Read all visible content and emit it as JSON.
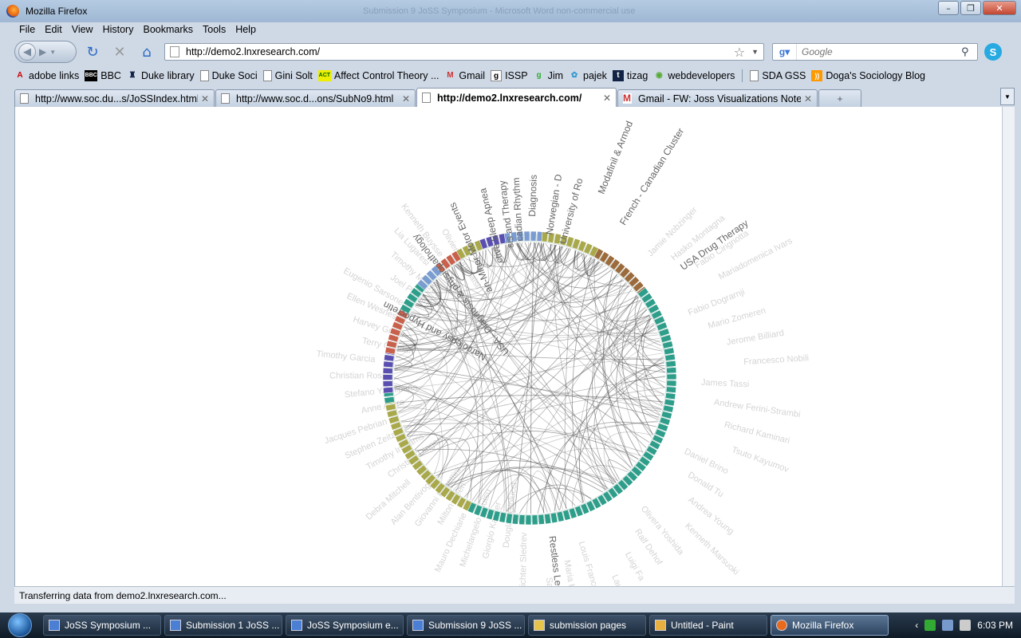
{
  "window": {
    "title": "Mozilla Firefox",
    "ghost_title": "Submission 9 JoSS Symposium - Microsoft Word non-commercial use"
  },
  "menu": [
    "File",
    "Edit",
    "View",
    "History",
    "Bookmarks",
    "Tools",
    "Help"
  ],
  "nav": {
    "url": "http://demo2.lnxresearch.com/",
    "search_placeholder": "Google"
  },
  "bookmarks": [
    {
      "label": "adobe links",
      "icon": "adobe-icon"
    },
    {
      "label": "BBC",
      "icon": "bbc-icon"
    },
    {
      "label": "Duke library",
      "icon": "duke-icon"
    },
    {
      "label": "Duke Soci",
      "icon": "page-icon"
    },
    {
      "label": "Gini Solt",
      "icon": "page-icon"
    },
    {
      "label": "Affect Control Theory ...",
      "icon": "act-icon"
    },
    {
      "label": "Gmail",
      "icon": "gmail-icon"
    },
    {
      "label": "ISSP",
      "icon": "issp-icon"
    },
    {
      "label": "Jim",
      "icon": "jim-icon"
    },
    {
      "label": "pajek",
      "icon": "pajek-icon"
    },
    {
      "label": "tizag",
      "icon": "tizag-icon"
    },
    {
      "label": "webdevelopers",
      "icon": "webdev-icon"
    },
    {
      "label": "SDA GSS",
      "icon": "page-icon"
    },
    {
      "label": "Doga's Sociology Blog",
      "icon": "rss-icon"
    }
  ],
  "tabs": [
    {
      "label": "http://www.soc.du...s/JoSSIndex.html",
      "active": false
    },
    {
      "label": "http://www.soc.d...ons/SubNo9.html",
      "active": false
    },
    {
      "label": "http://demo2.lnxresearch.com/",
      "active": true
    },
    {
      "label": "Gmail - FW: Joss Visualizations Note...",
      "active": false
    }
  ],
  "viz": {
    "clusters": [
      {
        "label": "Narcolepsy and Hypocretin"
      },
      {
        "label": "USA - Diagnosis & physiopathology"
      },
      {
        "label": "an-Minor Motor Events"
      },
      {
        "label": "ctive Sleep Apnea"
      },
      {
        "label": "sis and Therapy"
      },
      {
        "label": "cadian Rhythm"
      },
      {
        "label": "Diagnosis"
      },
      {
        "label": "Norwegian - D"
      },
      {
        "label": "University of Ro"
      },
      {
        "label": "Modafinil & Armod"
      },
      {
        "label": "French - Canadian Cluster"
      },
      {
        "label": "USA Drug Therapy"
      },
      {
        "label": "Restless Leg Syndrom"
      }
    ],
    "faded_names": [
      "Jamie Nobzinger",
      "Hasko Montagna",
      "Fabio Cirignotta",
      "Mariadomenica Ivars",
      "Fabio Dograrnji",
      "Mario Zomeren",
      "Jerome Billiard",
      "Francesco Nobili",
      "James Tassi",
      "Andrew Ferini-Strambi",
      "Richard Kaminari",
      "Tsuto Kayumov",
      "Daniel Brino",
      "Donald Tu",
      "Andrea Young",
      "Kenneth Marsuoki",
      "Olivera Yoshida",
      "Ralf Dehof",
      "Luigi Fa",
      "Laurens Ebeling",
      "Louis Franceschi",
      "Maria Hening",
      "Salvatore Gosa",
      "Richter Sledrev",
      "Douglas Giolucci",
      "Giorgio Kastler",
      "Michelangelo Koutsu",
      "Mauro Dechiarie",
      "Milton Geen",
      "Giovanni Rosettini",
      "Alan Bentivoglio",
      "Debra Mitchell",
      "Christine Dinges",
      "Timothy Ingrams",
      "Stephen Zeitzer",
      "Jacques Pebrian",
      "Anne Arora",
      "Stefano Yachibana",
      "Christian Rossi",
      "Timothy Garcia",
      "Terry Caanan",
      "Harvey Grisar",
      "Ellen Wesnes",
      "Eugenio Sarsone",
      "Joel Palatini",
      "Timothy Mazzeo",
      "Lia Lugaresi",
      "Kenneth Buysse",
      "Olivier Montplaisir"
    ]
  },
  "status": "Transferring data from demo2.lnxresearch.com...",
  "taskbar": {
    "items": [
      {
        "label": "JoSS Symposium ...",
        "active": false
      },
      {
        "label": "Submission 1 JoSS ...",
        "active": false
      },
      {
        "label": "JoSS Symposium e...",
        "active": false
      },
      {
        "label": "Submission 9 JoSS ...",
        "active": false
      },
      {
        "label": "submission pages",
        "active": false
      },
      {
        "label": "Untitled - Paint",
        "active": false
      },
      {
        "label": "Mozilla Firefox",
        "active": true
      }
    ],
    "clock": "6:03 PM"
  },
  "colors": {
    "chord": "#555555",
    "ring_teal": "#2e9e8a",
    "ring_olive": "#a9a84a",
    "ring_brown": "#9c6b3c",
    "ring_purple": "#5a4fb0",
    "ring_red": "#c8604c",
    "ring_blue": "#7a9cd0"
  }
}
